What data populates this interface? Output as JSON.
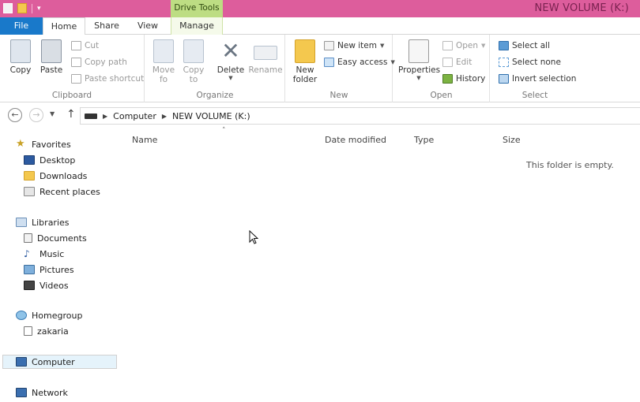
{
  "window": {
    "title": "NEW VOLUME (K:)",
    "context_tab": "Drive Tools"
  },
  "tabs": {
    "file": "File",
    "home": "Home",
    "share": "Share",
    "view": "View",
    "manage": "Manage"
  },
  "ribbon": {
    "clipboard": {
      "label": "Clipboard",
      "copy": "Copy",
      "paste": "Paste",
      "cut": "Cut",
      "copy_path": "Copy path",
      "paste_shortcut": "Paste shortcut"
    },
    "organize": {
      "label": "Organize",
      "move_to_1": "Move",
      "move_to_2": "fo",
      "copy_to_1": "Copy",
      "copy_to_2": "to",
      "delete": "Delete",
      "rename": "Rename"
    },
    "new": {
      "label": "New",
      "new_folder_1": "New",
      "new_folder_2": "folder",
      "new_item": "New item",
      "easy_access": "Easy access"
    },
    "open": {
      "label": "Open",
      "properties": "Properties",
      "open": "Open",
      "edit": "Edit",
      "history": "History"
    },
    "select": {
      "label": "Select",
      "select_all": "Select all",
      "select_none": "Select none",
      "invert": "Invert selection"
    }
  },
  "address": {
    "crumbs": [
      "Computer",
      "NEW VOLUME (K:)"
    ]
  },
  "nav": {
    "favorites": "Favorites",
    "desktop": "Desktop",
    "downloads": "Downloads",
    "recent": "Recent places",
    "libraries": "Libraries",
    "documents": "Documents",
    "music": "Music",
    "pictures": "Pictures",
    "videos": "Videos",
    "homegroup": "Homegroup",
    "user": "zakaria",
    "computer": "Computer",
    "network": "Network"
  },
  "columns": {
    "name": "Name",
    "date": "Date modified",
    "type": "Type",
    "size": "Size"
  },
  "empty_message": "This folder is empty.",
  "colors": {
    "title_bar": "#dd5d9c",
    "file_tab": "#1979ca",
    "context_tab": "#bddd83"
  }
}
